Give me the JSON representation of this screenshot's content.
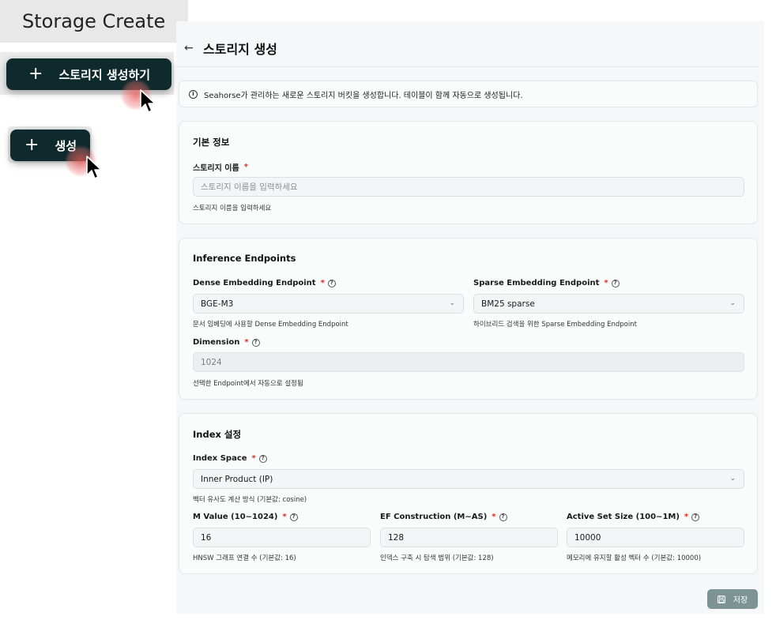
{
  "caption": "Storage Create",
  "annotation_buttons": {
    "large_plus": "+",
    "large_label": "스토리지 생성하기",
    "small_plus": "+",
    "small_label": "생성"
  },
  "header": {
    "back_icon": "←",
    "title": "스토리지 생성"
  },
  "notice": {
    "icon": "info-icon",
    "text": "Seahorse가 관리하는 새로운 스토리지 버킷을 생성합니다. 테이블이 함께 자동으로 생성됩니다."
  },
  "basic_info": {
    "title": "기본 정보",
    "name_label": "스토리지 이름",
    "required_mark": "*",
    "name_placeholder": "스토리지 이름을 입력하세요",
    "name_hint": "스토리지 이름을 입력하세요"
  },
  "inference": {
    "title": "Inference Endpoints",
    "dense_label": "Dense Embedding Endpoint",
    "dense_value": "BGE-M3",
    "dense_hint": "문서 임베딩에 사용할 Dense Embedding Endpoint",
    "sparse_label": "Sparse Embedding Endpoint",
    "sparse_value": "BM25 sparse",
    "sparse_hint": "하이브리드 검색을 위한 Sparse Embedding Endpoint",
    "dimension_label": "Dimension",
    "dimension_value": "1024",
    "dimension_hint": "선택한 Endpoint에서 자동으로 설정됨"
  },
  "index": {
    "title": "Index 설정",
    "space_label": "Index Space",
    "space_value": "Inner Product (IP)",
    "space_hint": "벡터 유사도 계산 방식 (기본값: cosine)",
    "m_label": "M Value (10~1024)",
    "m_value": "16",
    "m_hint": "HNSW 그래프 연결 수 (기본값: 16)",
    "ef_label": "EF Construction (M~AS)",
    "ef_value": "128",
    "ef_hint": "인덱스 구축 시 탐색 범위 (기본값: 128)",
    "as_label": "Active Set Size (100~1M)",
    "as_value": "10000",
    "as_hint": "메모리에 유지할 활성 벡터 수 (기본값: 10000)"
  },
  "footer": {
    "save_icon": "save-icon",
    "save_label": "저장"
  },
  "colors": {
    "primary_dark": "#0f2a2c",
    "save_button": "#7c9594",
    "required": "#d92d20",
    "click_highlight": "#f05a5a"
  }
}
